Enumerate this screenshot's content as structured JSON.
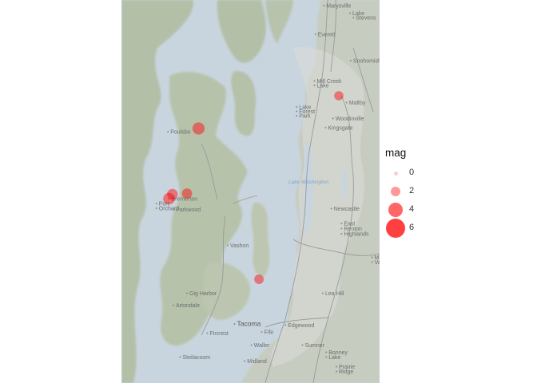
{
  "map": {
    "basemap": "terrain",
    "region": "Puget Sound",
    "bounds": {
      "lon": [
        -122.78,
        -122.02
      ],
      "lat": [
        47.11,
        48.07
      ]
    },
    "point_color": "#ff0000",
    "point_opacity": 0.45,
    "places": [
      {
        "name": "Marysville",
        "lon": -122.177,
        "lat": 48.051,
        "kind": "town"
      },
      {
        "name": "Lake",
        "lon": -122.1,
        "lat": 48.032,
        "kind": "town"
      },
      {
        "name": "Stevens",
        "lon": -122.09,
        "lat": 48.021,
        "kind": "town"
      },
      {
        "name": "Everett",
        "lon": -122.202,
        "lat": 47.979,
        "kind": "town"
      },
      {
        "name": "Snohomish",
        "lon": -122.098,
        "lat": 47.913,
        "kind": "town"
      },
      {
        "name": "Mill Creek",
        "lon": -122.205,
        "lat": 47.862,
        "kind": "town"
      },
      {
        "name": "Lake",
        "lon": -122.205,
        "lat": 47.851,
        "kind": "town"
      },
      {
        "name": "Maltby",
        "lon": -122.11,
        "lat": 47.808,
        "kind": "town"
      },
      {
        "name": "Lake",
        "lon": -122.257,
        "lat": 47.797,
        "kind": "town"
      },
      {
        "name": "Forest",
        "lon": -122.257,
        "lat": 47.786,
        "kind": "town"
      },
      {
        "name": "Park",
        "lon": -122.257,
        "lat": 47.775,
        "kind": "town"
      },
      {
        "name": "Woodinville",
        "lon": -122.15,
        "lat": 47.768,
        "kind": "town"
      },
      {
        "name": "Kingsgate",
        "lon": -122.172,
        "lat": 47.745,
        "kind": "town"
      },
      {
        "name": "Poulsbo",
        "lon": -122.636,
        "lat": 47.735,
        "kind": "town"
      },
      {
        "name": "Bremerton",
        "lon": -122.633,
        "lat": 47.567,
        "kind": "town"
      },
      {
        "name": "Port",
        "lon": -122.67,
        "lat": 47.555,
        "kind": "town"
      },
      {
        "name": "Orchard",
        "lon": -122.67,
        "lat": 47.543,
        "kind": "town"
      },
      {
        "name": "Parkwood",
        "lon": -122.62,
        "lat": 47.54,
        "kind": "town"
      },
      {
        "name": "Newcastle",
        "lon": -122.155,
        "lat": 47.542,
        "kind": "town"
      },
      {
        "name": "East",
        "lon": -122.125,
        "lat": 47.505,
        "kind": "town"
      },
      {
        "name": "Renton",
        "lon": -122.125,
        "lat": 47.492,
        "kind": "town"
      },
      {
        "name": "Highlands",
        "lon": -122.125,
        "lat": 47.479,
        "kind": "town"
      },
      {
        "name": "Vashon",
        "lon": -122.46,
        "lat": 47.45,
        "kind": "town"
      },
      {
        "name": "Maple",
        "lon": -122.035,
        "lat": 47.42,
        "kind": "town"
      },
      {
        "name": "Valley",
        "lon": -122.035,
        "lat": 47.408,
        "kind": "town"
      },
      {
        "name": "Lea Hill",
        "lon": -122.18,
        "lat": 47.33,
        "kind": "town"
      },
      {
        "name": "Gig Harbor",
        "lon": -122.58,
        "lat": 47.33,
        "kind": "town"
      },
      {
        "name": "Artondale",
        "lon": -122.62,
        "lat": 47.3,
        "kind": "town"
      },
      {
        "name": "Tacoma",
        "lon": -122.44,
        "lat": 47.253,
        "kind": "city"
      },
      {
        "name": "Edgewood",
        "lon": -122.29,
        "lat": 47.25,
        "kind": "town"
      },
      {
        "name": "Fircrest",
        "lon": -122.52,
        "lat": 47.23,
        "kind": "town"
      },
      {
        "name": "Fife",
        "lon": -122.36,
        "lat": 47.233,
        "kind": "town"
      },
      {
        "name": "Bonney",
        "lon": -122.17,
        "lat": 47.182,
        "kind": "town"
      },
      {
        "name": "Lake",
        "lon": -122.17,
        "lat": 47.17,
        "kind": "town"
      },
      {
        "name": "Waller",
        "lon": -122.39,
        "lat": 47.2,
        "kind": "town"
      },
      {
        "name": "Sumner",
        "lon": -122.24,
        "lat": 47.2,
        "kind": "town"
      },
      {
        "name": "Prairie",
        "lon": -122.14,
        "lat": 47.146,
        "kind": "town"
      },
      {
        "name": "Ridge",
        "lon": -122.14,
        "lat": 47.134,
        "kind": "town"
      },
      {
        "name": "Steilacoom",
        "lon": -122.6,
        "lat": 47.17,
        "kind": "town"
      },
      {
        "name": "Midland",
        "lon": -122.41,
        "lat": 47.16,
        "kind": "town"
      }
    ],
    "water_labels": [
      {
        "name": "Lake Washington",
        "lon": -122.26,
        "lat": 47.61
      }
    ],
    "points": [
      {
        "lon": -122.553,
        "lat": 47.748,
        "mag": 3.4
      },
      {
        "lon": -122.63,
        "lat": 47.583,
        "mag": 2.8
      },
      {
        "lon": -122.587,
        "lat": 47.585,
        "mag": 2.6
      },
      {
        "lon": -122.64,
        "lat": 47.572,
        "mag": 3.2
      },
      {
        "lon": -122.375,
        "lat": 47.37,
        "mag": 2.3
      },
      {
        "lon": -122.14,
        "lat": 47.83,
        "mag": 2.2
      }
    ]
  },
  "legend": {
    "title": "mag",
    "entries": [
      {
        "label": "0",
        "value": 0
      },
      {
        "label": "2",
        "value": 2
      },
      {
        "label": "4",
        "value": 4
      },
      {
        "label": "6",
        "value": 6
      }
    ]
  }
}
